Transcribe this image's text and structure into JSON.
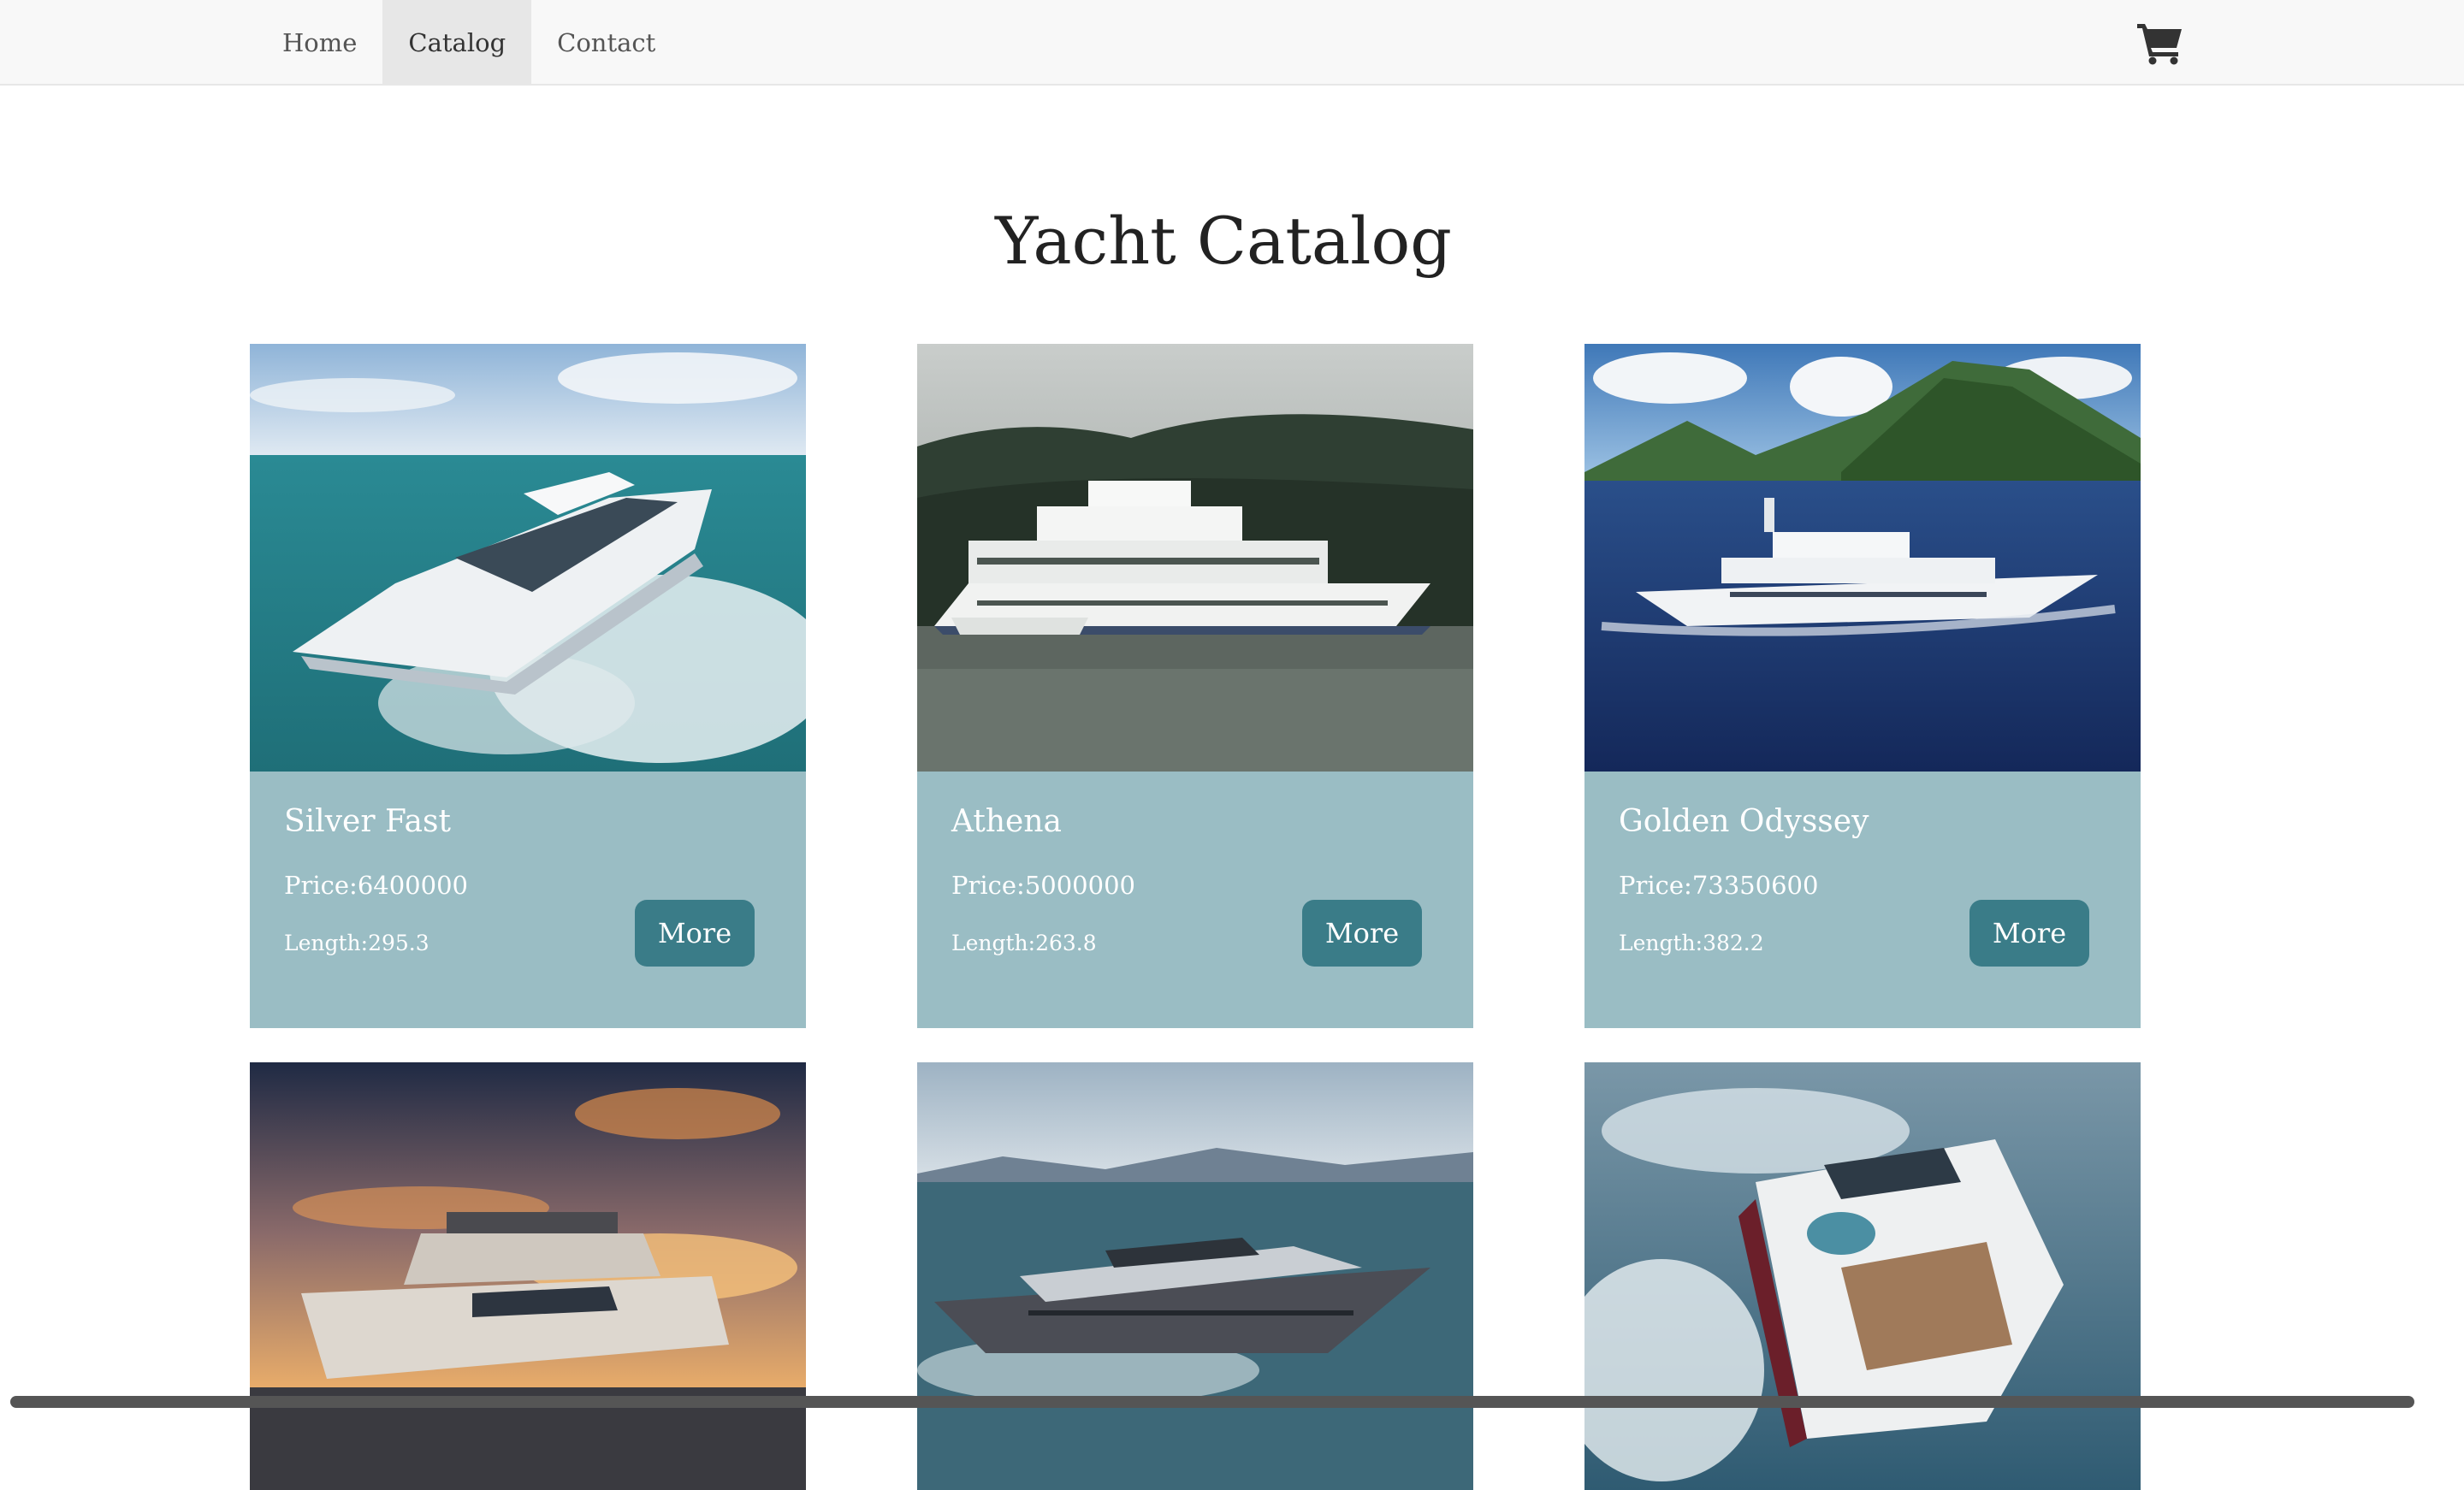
{
  "nav": {
    "links": [
      {
        "label": "Home",
        "active": false
      },
      {
        "label": "Catalog",
        "active": true
      },
      {
        "label": "Contact",
        "active": false
      }
    ],
    "cart_icon": "shopping-cart-icon"
  },
  "page": {
    "title": "Yacht Catalog"
  },
  "cards": [
    {
      "name": "Silver Fast",
      "price": "Price:6400000",
      "length": "Length:295.3",
      "more_label": "More",
      "image": "yacht-photo-turquoise-sea"
    },
    {
      "name": "Athena",
      "price": "Price:5000000",
      "length": "Length:263.8",
      "more_label": "More",
      "image": "yacht-photo-misty-forest"
    },
    {
      "name": "Golden Odyssey",
      "price": "Price:73350600",
      "length": "Length:382.2",
      "more_label": "More",
      "image": "yacht-photo-tropical-island"
    },
    {
      "image": "yacht-photo-sunset"
    },
    {
      "image": "yacht-photo-dark-hull"
    },
    {
      "image": "yacht-photo-rear-view"
    }
  ],
  "colors": {
    "nav_bg": "#f8f8f8",
    "nav_active_bg": "#e7e7e7",
    "card_body_bg": "#9abdc4",
    "button_bg": "#3a7c88"
  }
}
